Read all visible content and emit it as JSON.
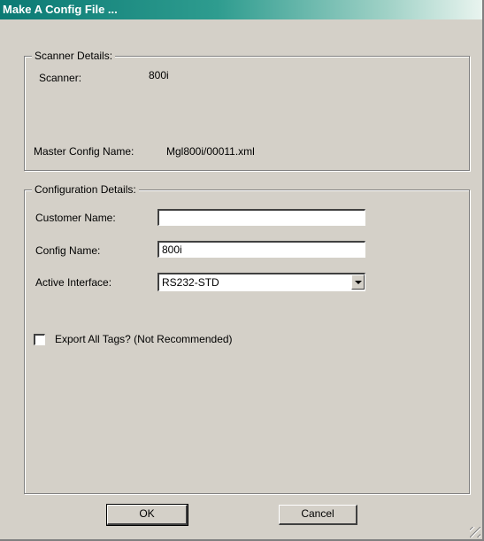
{
  "window": {
    "title": "Make A Config File ..."
  },
  "scanner_details": {
    "legend": "Scanner Details:",
    "scanner_label": "Scanner:",
    "scanner_value": "800i",
    "master_config_label": "Master Config Name:",
    "master_config_value": "Mgl800i/00011.xml"
  },
  "configuration_details": {
    "legend": "Configuration Details:",
    "customer_name_label": "Customer Name:",
    "customer_name_value": "",
    "config_name_label": "Config Name:",
    "config_name_value": "800i",
    "active_interface_label": "Active Interface:",
    "active_interface_value": "RS232-STD",
    "export_all_label": "Export All Tags? (Not Recommended)",
    "export_all_checked": false
  },
  "buttons": {
    "ok_label": "OK",
    "cancel_label": "Cancel"
  }
}
